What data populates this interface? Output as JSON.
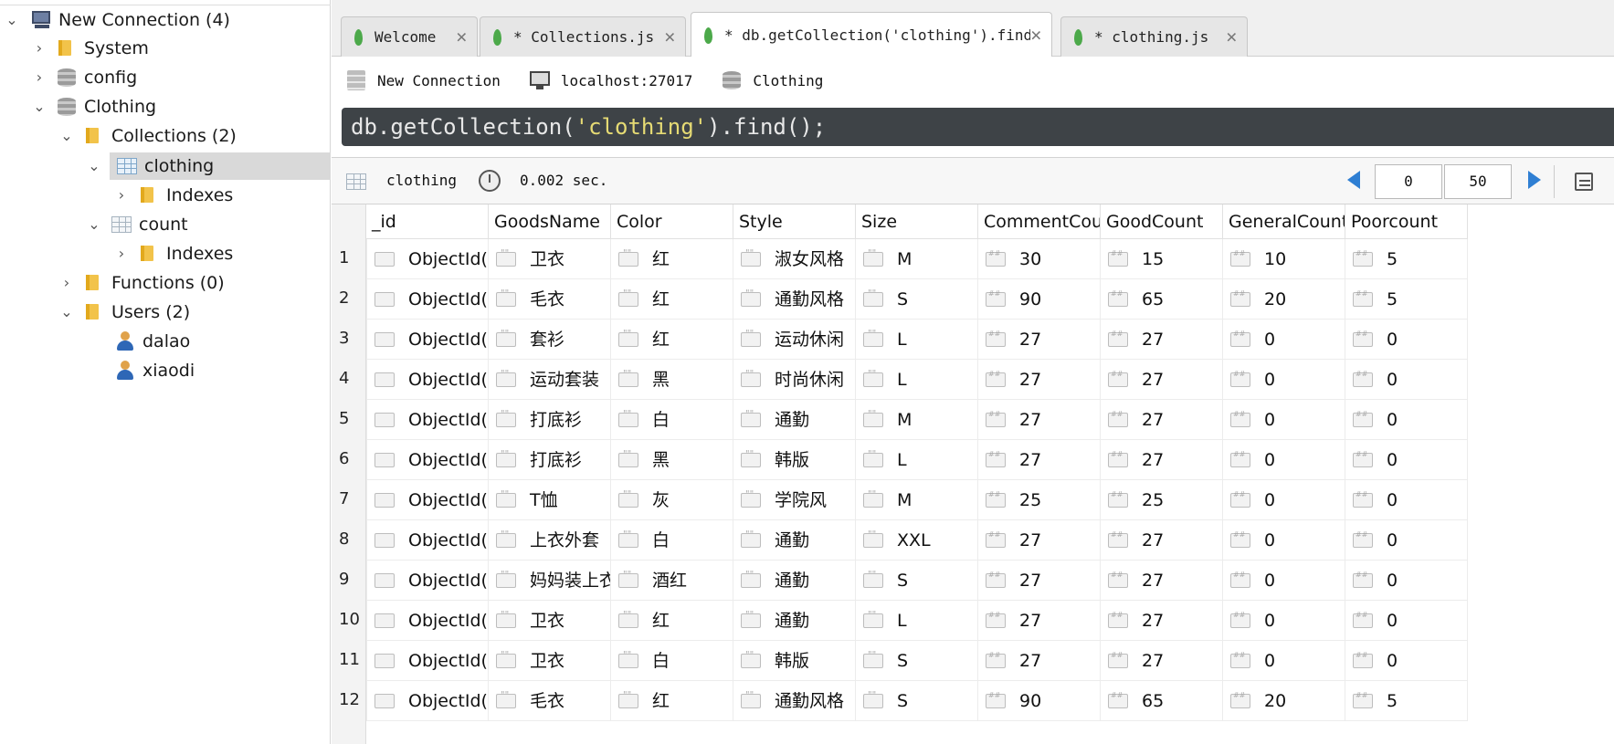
{
  "sidebar": {
    "connection": "New Connection (4)",
    "system": "System",
    "config": "config",
    "clothing_db": "Clothing",
    "collections": "Collections (2)",
    "collection_clothing": "clothing",
    "indexes_1": "Indexes",
    "collection_count": "count",
    "indexes_2": "Indexes",
    "functions": "Functions (0)",
    "users": "Users (2)",
    "user_1": "dalao",
    "user_2": "xiaodi"
  },
  "tabs": [
    {
      "label": "Welcome"
    },
    {
      "label": "* Collections.js"
    },
    {
      "label": "* db.getCollection('clothing').find…"
    },
    {
      "label": "* clothing.js"
    }
  ],
  "connbar": {
    "connection": "New Connection",
    "host": "localhost:27017",
    "database": "Clothing"
  },
  "editor": {
    "prefix": "db.getCollection(",
    "arg": "'clothing'",
    "suffix": ").find();"
  },
  "results": {
    "collection": "clothing",
    "time": "0.002 sec.",
    "page_from": "0",
    "page_size": "50"
  },
  "table": {
    "columns": [
      "_id",
      "GoodsName",
      "Color",
      "Style",
      "Size",
      "CommentCount",
      "GoodCount",
      "GeneralCount",
      "Poorcount"
    ],
    "rows": [
      [
        "ObjectId(...",
        "卫衣",
        "红",
        "淑女风格",
        "M",
        "30",
        "15",
        "10",
        "5"
      ],
      [
        "ObjectId(...",
        "毛衣",
        "红",
        "通勤风格",
        "S",
        "90",
        "65",
        "20",
        "5"
      ],
      [
        "ObjectId(...",
        "套衫",
        "红",
        "运动休闲",
        "L",
        "27",
        "27",
        "0",
        "0"
      ],
      [
        "ObjectId(...",
        "运动套装",
        "黑",
        "时尚休闲",
        "L",
        "27",
        "27",
        "0",
        "0"
      ],
      [
        "ObjectId(...",
        "打底衫",
        "白",
        "通勤",
        "M",
        "27",
        "27",
        "0",
        "0"
      ],
      [
        "ObjectId(...",
        "打底衫",
        "黑",
        "韩版",
        "L",
        "27",
        "27",
        "0",
        "0"
      ],
      [
        "ObjectId(...",
        "T恤",
        "灰",
        "学院风",
        "M",
        "25",
        "25",
        "0",
        "0"
      ],
      [
        "ObjectId(...",
        "上衣外套",
        "白",
        "通勤",
        "XXL",
        "27",
        "27",
        "0",
        "0"
      ],
      [
        "ObjectId(...",
        "妈妈装上衣",
        "酒红",
        "通勤",
        "S",
        "27",
        "27",
        "0",
        "0"
      ],
      [
        "ObjectId(...",
        "卫衣",
        "红",
        "通勤",
        "L",
        "27",
        "27",
        "0",
        "0"
      ],
      [
        "ObjectId(...",
        "卫衣",
        "白",
        "韩版",
        "S",
        "27",
        "27",
        "0",
        "0"
      ],
      [
        "ObjectId(...",
        "毛衣",
        "红",
        "通勤风格",
        "S",
        "90",
        "65",
        "20",
        "5"
      ]
    ]
  },
  "colors": {
    "editor_bg": "#3e4347",
    "string": "#e6db74",
    "selected_row": "#d9d9d9",
    "accent": "#2f7fd3"
  }
}
